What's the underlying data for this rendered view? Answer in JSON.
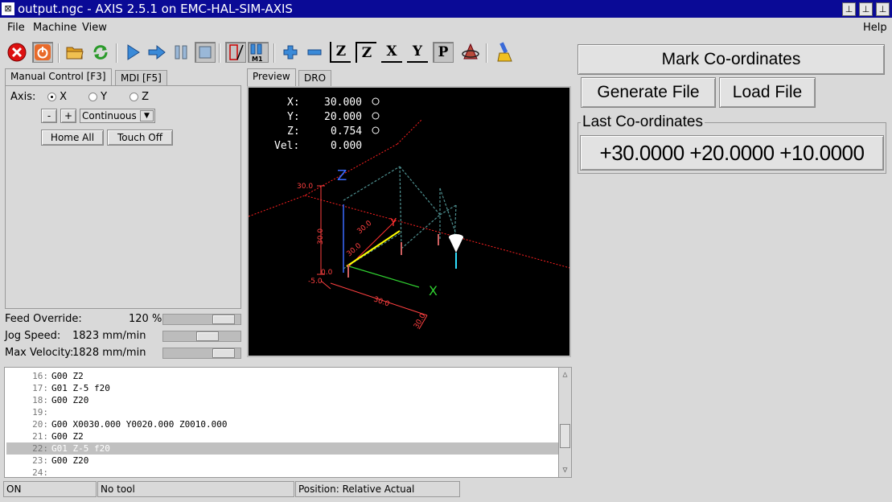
{
  "window": {
    "title": "output.ngc - AXIS 2.5.1 on EMC-HAL-SIM-AXIS",
    "icon_glyph": "⊠",
    "controls": [
      "⊥",
      "⊥",
      "⊥"
    ]
  },
  "menubar": {
    "file": "File",
    "machine": "Machine",
    "view": "View",
    "help": "Help"
  },
  "toolbar": {
    "icons": [
      "estop-icon",
      "power-icon",
      "open-file-icon",
      "reload-icon",
      "run-icon",
      "step-icon",
      "pause-icon",
      "stop-icon",
      "block-delete-icon",
      "optional-stop-icon",
      "zoom-in-icon",
      "zoom-out-icon",
      "view-z-icon",
      "view-z2-icon",
      "view-x-icon",
      "view-y-icon",
      "view-p-icon",
      "rotate-view-icon",
      "clear-plot-icon"
    ],
    "labels": {
      "z": "Z",
      "z2": "Z",
      "x": "X",
      "y": "Y",
      "p": "P",
      "m1": "M1"
    }
  },
  "left_tabs": {
    "manual": "Manual Control [F3]",
    "mdi": "MDI [F5]"
  },
  "manual": {
    "axis_label": "Axis:",
    "axes": [
      {
        "label": "X",
        "selected": true
      },
      {
        "label": "Y",
        "selected": false
      },
      {
        "label": "Z",
        "selected": false
      }
    ],
    "minus": "-",
    "plus": "+",
    "jog_mode": "Continuous",
    "home_all": "Home All",
    "touch_off": "Touch Off"
  },
  "overrides": {
    "feed_label": "Feed Override:",
    "feed_value": "120 %",
    "feed_fraction": 0.9,
    "jog_label": "Jog Speed:",
    "jog_value": "1823 mm/min",
    "jog_fraction": 0.6,
    "maxvel_label": "Max Velocity:",
    "maxvel_value": "1828 mm/min",
    "maxvel_fraction": 0.9
  },
  "preview_tabs": {
    "preview": "Preview",
    "dro": "DRO"
  },
  "dro": [
    {
      "axis": "X:",
      "value": "30.000"
    },
    {
      "axis": "Y:",
      "value": "20.000"
    },
    {
      "axis": "Z:",
      "value": "0.754"
    },
    {
      "axis": "Vel:",
      "value": "0.000"
    }
  ],
  "plot": {
    "labels": {
      "z_axis": "Z",
      "x_axis": "X",
      "y_axis": "Y",
      "dim_30": "30.0",
      "dim_30b": "30.0",
      "dim_30c": "30.0",
      "dim_30d": "30.0",
      "dim_00": "0.0",
      "dim_neg5": "-5.0",
      "dim_30e": "30.0",
      "dim_30f": "30.0"
    },
    "colors": {
      "background": "#000000",
      "grid": "#ff2020",
      "rapid": "#4d8f8f",
      "feed": "#ffff00",
      "tool": "#ffffff"
    }
  },
  "right": {
    "mark": "Mark Co-ordinates",
    "generate": "Generate File",
    "load": "Load File",
    "last_label": "Last Co-ordinates",
    "coords": "+30.0000 +20.0000 +10.0000"
  },
  "gcode": [
    {
      "n": "16:",
      "code": "G00 Z2"
    },
    {
      "n": "17:",
      "code": "G01 Z-5 f20"
    },
    {
      "n": "18:",
      "code": "G00 Z20"
    },
    {
      "n": "19:",
      "code": ""
    },
    {
      "n": "20:",
      "code": "G00 X0030.000 Y0020.000 Z0010.000"
    },
    {
      "n": "21:",
      "code": "G00 Z2"
    },
    {
      "n": "22:",
      "code": "G01 Z-5 f20",
      "highlight": true
    },
    {
      "n": "23:",
      "code": "G00 Z20"
    },
    {
      "n": "24:",
      "code": ""
    }
  ],
  "status": {
    "state": "ON",
    "tool": "No tool",
    "position": "Position: Relative Actual"
  }
}
